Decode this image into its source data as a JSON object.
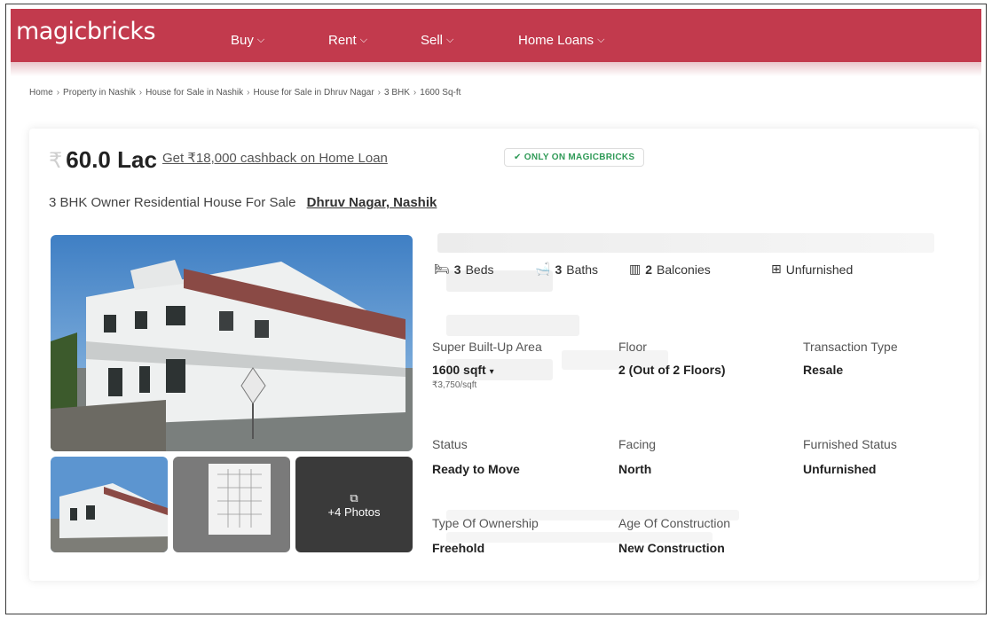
{
  "header": {
    "logo": "magicbricks",
    "nav": [
      {
        "label": "Buy"
      },
      {
        "label": "Rent"
      },
      {
        "label": "Sell"
      },
      {
        "label": "Home Loans"
      }
    ]
  },
  "breadcrumb": [
    "Home",
    "Property in Nashik",
    "House for Sale in Nashik",
    "House for Sale in Dhruv Nagar",
    "3 BHK",
    "1600 Sq-ft"
  ],
  "listing": {
    "price": "60.0 Lac",
    "cashback": "Get ₹18,000 cashback on Home Loan",
    "badge": "ONLY ON MAGICBRICKS",
    "title": "3 BHK Owner Residential House For Sale",
    "location": "Dhruv Nagar, Nashik",
    "photos_more": "+4 Photos",
    "amenities": {
      "beds_count": "3",
      "beds_label": "Beds",
      "baths_count": "3",
      "baths_label": "Baths",
      "balconies_count": "2",
      "balconies_label": "Balconies",
      "furnishing": "Unfurnished"
    },
    "details": {
      "area_label": "Super Built-Up Area",
      "area_value": "1600 sqft",
      "area_rate": "₹3,750/sqft",
      "floor_label": "Floor",
      "floor_value": "2 (Out of 2 Floors)",
      "transaction_label": "Transaction Type",
      "transaction_value": "Resale",
      "status_label": "Status",
      "status_value": "Ready to Move",
      "facing_label": "Facing",
      "facing_value": "North",
      "furnished_label": "Furnished Status",
      "furnished_value": "Unfurnished",
      "ownership_label": "Type Of Ownership",
      "ownership_value": "Freehold",
      "age_label": "Age Of Construction",
      "age_value": "New Construction"
    }
  },
  "colors": {
    "brand": "#c23a4d",
    "badge_green": "#2f9a57"
  },
  "icons": {
    "bed": "bed-icon",
    "bath": "bath-icon",
    "balcony": "balcony-icon",
    "furnishing": "window-icon",
    "check": "check-icon",
    "chevron": "chevron-down-icon",
    "photos": "image-icon",
    "more": "more-vertical-icon"
  }
}
